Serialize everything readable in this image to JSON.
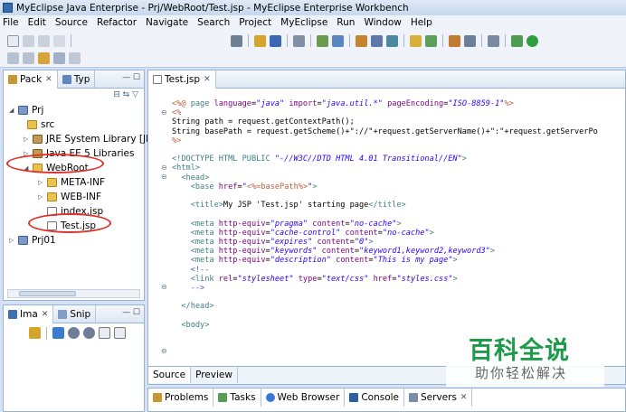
{
  "window": {
    "title": "MyEclipse Java Enterprise - Prj/WebRoot/Test.jsp - MyEclipse Enterprise Workbench"
  },
  "menu": [
    "File",
    "Edit",
    "Source",
    "Refactor",
    "Navigate",
    "Search",
    "Project",
    "MyEclipse",
    "Run",
    "Window",
    "Help"
  ],
  "left_panel": {
    "tabs": [
      {
        "label": "Pack",
        "icon": "package-explorer-icon"
      },
      {
        "label": "Typ",
        "icon": "type-hierarchy-icon"
      }
    ],
    "tree": [
      {
        "label": "Prj",
        "icon": "project-icon",
        "twisty": "expanded"
      },
      {
        "label": "src",
        "icon": "source-folder-icon",
        "twisty": ""
      },
      {
        "label": "JRE System Library [JD",
        "icon": "library-icon",
        "twisty": "collapsed"
      },
      {
        "label": "Java EE 5 Libraries",
        "icon": "library-icon",
        "twisty": "collapsed"
      },
      {
        "label": "WebRoot",
        "icon": "folder-icon",
        "twisty": "expanded"
      },
      {
        "label": "META-INF",
        "icon": "folder-icon",
        "twisty": "collapsed"
      },
      {
        "label": "WEB-INF",
        "icon": "folder-icon",
        "twisty": "collapsed"
      },
      {
        "label": "index.jsp",
        "icon": "jsp-file-icon",
        "twisty": ""
      },
      {
        "label": "Test.jsp",
        "icon": "jsp-file-icon",
        "twisty": ""
      },
      {
        "label": "Prj01",
        "icon": "project-icon",
        "twisty": "collapsed"
      }
    ]
  },
  "lower_left_panel": {
    "tabs": [
      {
        "label": "Ima",
        "icon": "image-preview-icon"
      },
      {
        "label": "Snip",
        "icon": "snippets-icon"
      }
    ]
  },
  "editor": {
    "tab_label": "Test.jsp",
    "lines": [
      [
        [
          "dir",
          "<%@ "
        ],
        [
          "tag",
          "page "
        ],
        [
          "attr",
          "language"
        ],
        [
          "t",
          "="
        ],
        [
          "val",
          "\"java\""
        ],
        [
          "t",
          " "
        ],
        [
          "attr",
          "import"
        ],
        [
          "t",
          "="
        ],
        [
          "val",
          "\"java.util.*\""
        ],
        [
          "t",
          " "
        ],
        [
          "attr",
          "pageEncoding"
        ],
        [
          "t",
          "="
        ],
        [
          "val",
          "\"ISO-8859-1\""
        ],
        [
          "dir",
          "%>"
        ]
      ],
      [
        [
          "dir",
          "<%"
        ]
      ],
      [
        [
          "t",
          "String path = request.getContextPath();"
        ]
      ],
      [
        [
          "t",
          "String basePath = request.getScheme()+\"://\"+request.getServerName()+\":\"+request.getServerPo"
        ]
      ],
      [
        [
          "dir",
          "%>"
        ]
      ],
      [
        [
          "t",
          ""
        ]
      ],
      [
        [
          "tag",
          "<!DOCTYPE HTML PUBLIC "
        ],
        [
          "val",
          "\"-//W3C//DTD HTML 4.01 Transitional//EN\""
        ],
        [
          "tag",
          ">"
        ]
      ],
      [
        [
          "tag",
          "<html>"
        ]
      ],
      [
        [
          "tag",
          "  <head>"
        ]
      ],
      [
        [
          "tag",
          "    <base "
        ],
        [
          "attr",
          "href"
        ],
        [
          "t",
          "="
        ],
        [
          "val",
          "\""
        ],
        [
          "dir",
          "<%=basePath%>"
        ],
        [
          "val",
          "\""
        ],
        [
          "tag",
          ">"
        ]
      ],
      [
        [
          "t",
          ""
        ]
      ],
      [
        [
          "tag",
          "    <title>"
        ],
        [
          "t",
          "My JSP 'Test.jsp' starting page"
        ],
        [
          "tag",
          "</title>"
        ]
      ],
      [
        [
          "t",
          ""
        ]
      ],
      [
        [
          "tag",
          "    <meta "
        ],
        [
          "attr",
          "http-equiv"
        ],
        [
          "t",
          "="
        ],
        [
          "val",
          "\"pragma\""
        ],
        [
          "t",
          " "
        ],
        [
          "attr",
          "content"
        ],
        [
          "t",
          "="
        ],
        [
          "val",
          "\"no-cache\""
        ],
        [
          "tag",
          ">"
        ]
      ],
      [
        [
          "tag",
          "    <meta "
        ],
        [
          "attr",
          "http-equiv"
        ],
        [
          "t",
          "="
        ],
        [
          "val",
          "\"cache-control\""
        ],
        [
          "t",
          " "
        ],
        [
          "attr",
          "content"
        ],
        [
          "t",
          "="
        ],
        [
          "val",
          "\"no-cache\""
        ],
        [
          "tag",
          ">"
        ]
      ],
      [
        [
          "tag",
          "    <meta "
        ],
        [
          "attr",
          "http-equiv"
        ],
        [
          "t",
          "="
        ],
        [
          "val",
          "\"expires\""
        ],
        [
          "t",
          " "
        ],
        [
          "attr",
          "content"
        ],
        [
          "t",
          "="
        ],
        [
          "val",
          "\"0\""
        ],
        [
          "tag",
          ">"
        ]
      ],
      [
        [
          "tag",
          "    <meta "
        ],
        [
          "attr",
          "http-equiv"
        ],
        [
          "t",
          "="
        ],
        [
          "val",
          "\"keywords\""
        ],
        [
          "t",
          " "
        ],
        [
          "attr",
          "content"
        ],
        [
          "t",
          "="
        ],
        [
          "val",
          "\"keyword1,keyword2,keyword3\""
        ],
        [
          "tag",
          ">"
        ]
      ],
      [
        [
          "tag",
          "    <meta "
        ],
        [
          "attr",
          "http-equiv"
        ],
        [
          "t",
          "="
        ],
        [
          "val",
          "\"description\""
        ],
        [
          "t",
          " "
        ],
        [
          "attr",
          "content"
        ],
        [
          "t",
          "="
        ],
        [
          "val",
          "\"This is my page\""
        ],
        [
          "tag",
          ">"
        ]
      ],
      [
        [
          "cmt",
          "    <!--"
        ]
      ],
      [
        [
          "tag",
          "    <link "
        ],
        [
          "attr",
          "rel"
        ],
        [
          "t",
          "="
        ],
        [
          "val",
          "\"stylesheet\""
        ],
        [
          "t",
          " "
        ],
        [
          "attr",
          "type"
        ],
        [
          "t",
          "="
        ],
        [
          "val",
          "\"text/css\""
        ],
        [
          "t",
          " "
        ],
        [
          "attr",
          "href"
        ],
        [
          "t",
          "="
        ],
        [
          "val",
          "\"styles.css\""
        ],
        [
          "tag",
          ">"
        ]
      ],
      [
        [
          "cmt",
          "    -->"
        ]
      ],
      [
        [
          "t",
          ""
        ]
      ],
      [
        [
          "tag",
          "  </head>"
        ]
      ],
      [
        [
          "t",
          ""
        ]
      ],
      [
        [
          "tag",
          "  <body>"
        ]
      ]
    ],
    "bottom_tabs": [
      "Source",
      "Preview"
    ]
  },
  "bottom_panel": {
    "tabs": [
      {
        "label": "Problems",
        "icon": "problems-icon"
      },
      {
        "label": "Tasks",
        "icon": "tasks-icon"
      },
      {
        "label": "Web Browser",
        "icon": "web-browser-icon"
      },
      {
        "label": "Console",
        "icon": "console-icon"
      },
      {
        "label": "Servers",
        "icon": "servers-icon"
      }
    ]
  },
  "watermark": {
    "title": "百科全说",
    "subtitle": "助你轻松解决"
  },
  "colors": {
    "annotation": "#e0302a",
    "watermark_green": "#1d9a4a"
  }
}
